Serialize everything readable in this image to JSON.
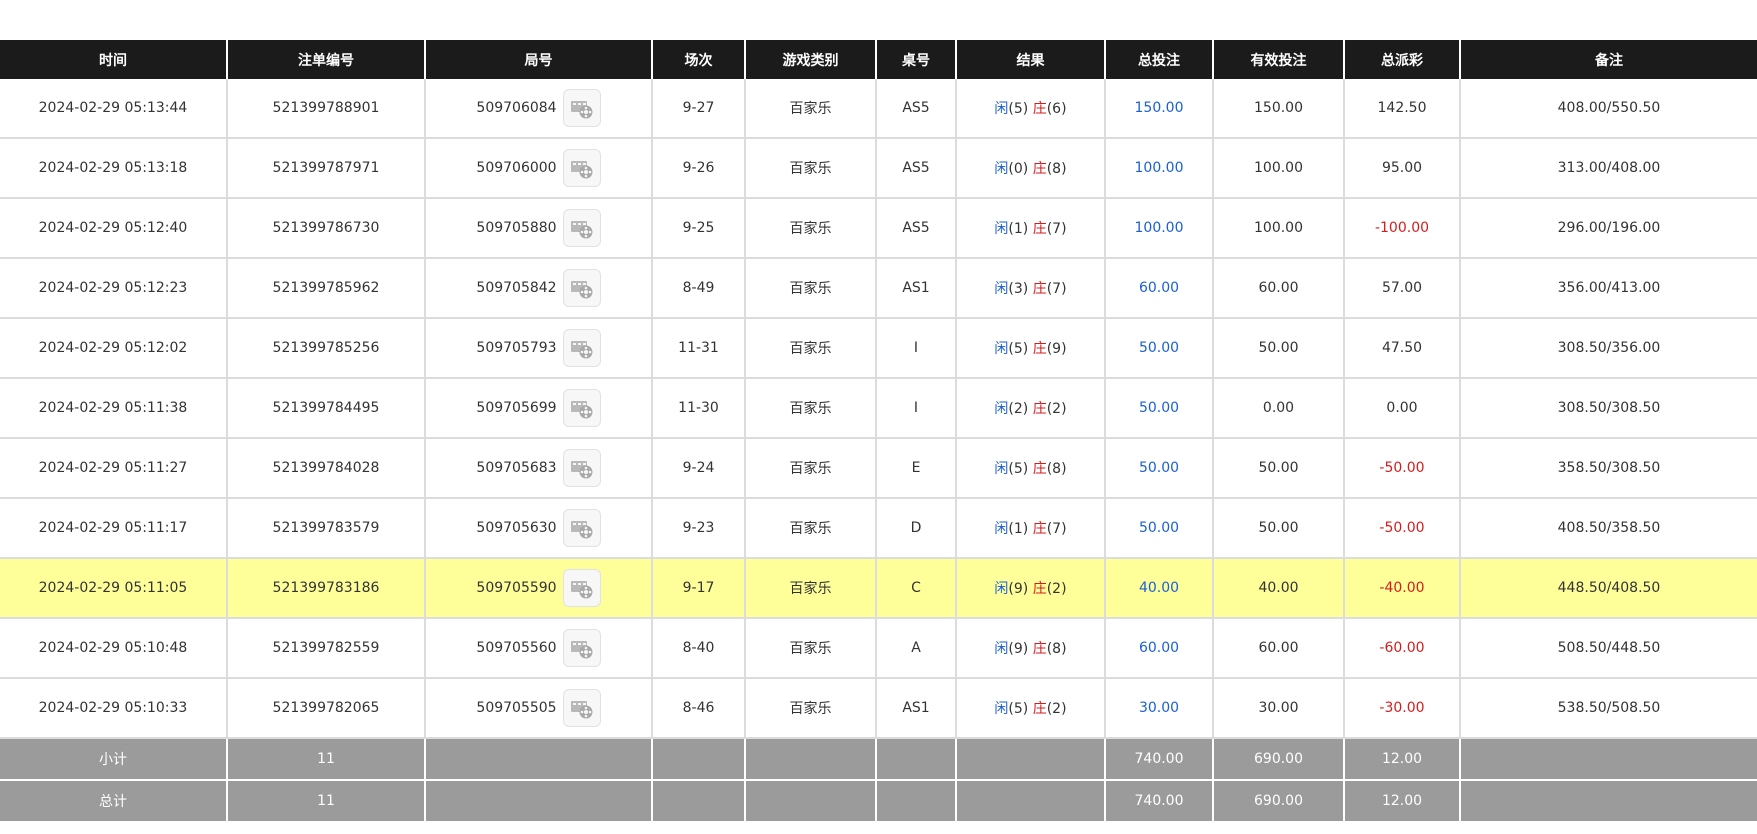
{
  "table": {
    "headers": [
      "时间",
      "注单编号",
      "局号",
      "场次",
      "游戏类别",
      "桌号",
      "结果",
      "总投注",
      "有效投注",
      "总派彩",
      "备注"
    ],
    "rows": [
      {
        "time": "2024-02-29 05:13:44",
        "bet_no": "521399788901",
        "round": "509706084",
        "session": "9-27",
        "game": "百家乐",
        "table": "AS5",
        "player_label": "闲",
        "player_score": "(5)",
        "banker_label": "庄",
        "banker_score": "(6)",
        "total_bet": "150.00",
        "valid_bet": "150.00",
        "payout": "142.50",
        "payout_negative": false,
        "note": "408.00/550.50"
      },
      {
        "time": "2024-02-29 05:13:18",
        "bet_no": "521399787971",
        "round": "509706000",
        "session": "9-26",
        "game": "百家乐",
        "table": "AS5",
        "player_label": "闲",
        "player_score": "(0)",
        "banker_label": "庄",
        "banker_score": "(8)",
        "total_bet": "100.00",
        "valid_bet": "100.00",
        "payout": "95.00",
        "payout_negative": false,
        "note": "313.00/408.00"
      },
      {
        "time": "2024-02-29 05:12:40",
        "bet_no": "521399786730",
        "round": "509705880",
        "session": "9-25",
        "game": "百家乐",
        "table": "AS5",
        "player_label": "闲",
        "player_score": "(1)",
        "banker_label": "庄",
        "banker_score": "(7)",
        "total_bet": "100.00",
        "valid_bet": "100.00",
        "payout": "-100.00",
        "payout_negative": true,
        "note": "296.00/196.00"
      },
      {
        "time": "2024-02-29 05:12:23",
        "bet_no": "521399785962",
        "round": "509705842",
        "session": "8-49",
        "game": "百家乐",
        "table": "AS1",
        "player_label": "闲",
        "player_score": "(3)",
        "banker_label": "庄",
        "banker_score": "(7)",
        "total_bet": "60.00",
        "valid_bet": "60.00",
        "payout": "57.00",
        "payout_negative": false,
        "note": "356.00/413.00"
      },
      {
        "time": "2024-02-29 05:12:02",
        "bet_no": "521399785256",
        "round": "509705793",
        "session": "11-31",
        "game": "百家乐",
        "table": "I",
        "player_label": "闲",
        "player_score": "(5)",
        "banker_label": "庄",
        "banker_score": "(9)",
        "total_bet": "50.00",
        "valid_bet": "50.00",
        "payout": "47.50",
        "payout_negative": false,
        "note": "308.50/356.00"
      },
      {
        "time": "2024-02-29 05:11:38",
        "bet_no": "521399784495",
        "round": "509705699",
        "session": "11-30",
        "game": "百家乐",
        "table": "I",
        "player_label": "闲",
        "player_score": "(2)",
        "banker_label": "庄",
        "banker_score": "(2)",
        "total_bet": "50.00",
        "valid_bet": "0.00",
        "payout": "0.00",
        "payout_negative": false,
        "note": "308.50/308.50"
      },
      {
        "time": "2024-02-29 05:11:27",
        "bet_no": "521399784028",
        "round": "509705683",
        "session": "9-24",
        "game": "百家乐",
        "table": "E",
        "player_label": "闲",
        "player_score": "(5)",
        "banker_label": "庄",
        "banker_score": "(8)",
        "total_bet": "50.00",
        "valid_bet": "50.00",
        "payout": "-50.00",
        "payout_negative": true,
        "note": "358.50/308.50"
      },
      {
        "time": "2024-02-29 05:11:17",
        "bet_no": "521399783579",
        "round": "509705630",
        "session": "9-23",
        "game": "百家乐",
        "table": "D",
        "player_label": "闲",
        "player_score": "(1)",
        "banker_label": "庄",
        "banker_score": "(7)",
        "total_bet": "50.00",
        "valid_bet": "50.00",
        "payout": "-50.00",
        "payout_negative": true,
        "note": "408.50/358.50"
      },
      {
        "time": "2024-02-29 05:11:05",
        "bet_no": "521399783186",
        "round": "509705590",
        "session": "9-17",
        "game": "百家乐",
        "table": "C",
        "player_label": "闲",
        "player_score": "(9)",
        "banker_label": "庄",
        "banker_score": "(2)",
        "total_bet": "40.00",
        "valid_bet": "40.00",
        "payout": "-40.00",
        "payout_negative": true,
        "note": "448.50/408.50",
        "highlighted": true
      },
      {
        "time": "2024-02-29 05:10:48",
        "bet_no": "521399782559",
        "round": "509705560",
        "session": "8-40",
        "game": "百家乐",
        "table": "A",
        "player_label": "闲",
        "player_score": "(9)",
        "banker_label": "庄",
        "banker_score": "(8)",
        "total_bet": "60.00",
        "valid_bet": "60.00",
        "payout": "-60.00",
        "payout_negative": true,
        "note": "508.50/448.50"
      },
      {
        "time": "2024-02-29 05:10:33",
        "bet_no": "521399782065",
        "round": "509705505",
        "session": "8-46",
        "game": "百家乐",
        "table": "AS1",
        "player_label": "闲",
        "player_score": "(5)",
        "banker_label": "庄",
        "banker_score": "(2)",
        "total_bet": "30.00",
        "valid_bet": "30.00",
        "payout": "-30.00",
        "payout_negative": true,
        "note": "538.50/508.50"
      }
    ],
    "subtotal": {
      "label": "小计",
      "count": "11",
      "total_bet": "740.00",
      "valid_bet": "690.00",
      "payout": "12.00"
    },
    "total": {
      "label": "总计",
      "count": "11",
      "total_bet": "740.00",
      "valid_bet": "690.00",
      "payout": "12.00"
    },
    "replay_icon": "film-reel-icon",
    "colors": {
      "header_bg": "#1b1b1b",
      "footer_bg": "#9b9b9b",
      "highlight_bg": "#ffff99",
      "player": "#1a5fd6",
      "banker": "#d41e1e",
      "negative": "#d41e1e"
    }
  }
}
